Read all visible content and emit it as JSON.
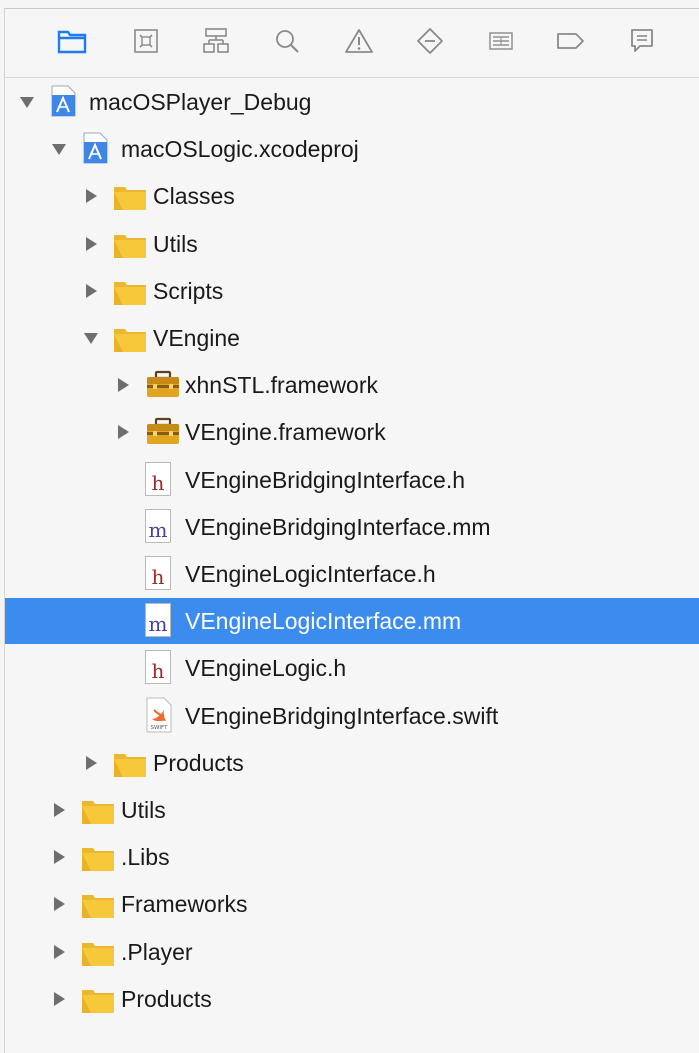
{
  "toolbar": {
    "icons": [
      "project-navigator-icon",
      "source-control-icon",
      "symbol-navigator-icon",
      "find-navigator-icon",
      "issue-navigator-icon",
      "test-navigator-icon",
      "debug-navigator-icon",
      "breakpoint-navigator-icon",
      "report-navigator-icon"
    ]
  },
  "colors": {
    "selection": "#3c8cf0",
    "folder": "#f7c93a",
    "header_file": "#9c2a2a",
    "objc_file": "#4b3ea3"
  },
  "tree": [
    {
      "label": "macOSPlayer_Debug",
      "icon": "workspace-project-icon",
      "expanded": true
    },
    {
      "label": "macOSLogic.xcodeproj",
      "icon": "xcode-project-icon",
      "expanded": true
    },
    {
      "label": "Classes",
      "icon": "folder-icon",
      "expanded": false
    },
    {
      "label": "Utils",
      "icon": "folder-icon",
      "expanded": false
    },
    {
      "label": "Scripts",
      "icon": "folder-icon",
      "expanded": false
    },
    {
      "label": "VEngine",
      "icon": "folder-icon",
      "expanded": true
    },
    {
      "label": "xhnSTL.framework",
      "icon": "framework-toolbox-icon",
      "expanded": false
    },
    {
      "label": "VEngine.framework",
      "icon": "framework-toolbox-icon",
      "expanded": false
    },
    {
      "label": "VEngineBridgingInterface.h",
      "icon": "header-file-icon",
      "letter": "h"
    },
    {
      "label": "VEngineBridgingInterface.mm",
      "icon": "objc-file-icon",
      "letter": "m"
    },
    {
      "label": "VEngineLogicInterface.h",
      "icon": "header-file-icon",
      "letter": "h"
    },
    {
      "label": "VEngineLogicInterface.mm",
      "icon": "objc-file-icon",
      "letter": "m",
      "selected": true
    },
    {
      "label": "VEngineLogic.h",
      "icon": "header-file-icon",
      "letter": "h"
    },
    {
      "label": "VEngineBridgingInterface.swift",
      "icon": "swift-file-icon",
      "badge": "SWIFT"
    },
    {
      "label": "Products",
      "icon": "folder-icon",
      "expanded": false
    },
    {
      "label": "Utils",
      "icon": "folder-icon",
      "expanded": false
    },
    {
      "label": ".Libs",
      "icon": "folder-icon",
      "expanded": false
    },
    {
      "label": "Frameworks",
      "icon": "folder-icon",
      "expanded": false
    },
    {
      "label": ".Player",
      "icon": "folder-icon",
      "expanded": false
    },
    {
      "label": "Products",
      "icon": "folder-icon",
      "expanded": false
    }
  ]
}
